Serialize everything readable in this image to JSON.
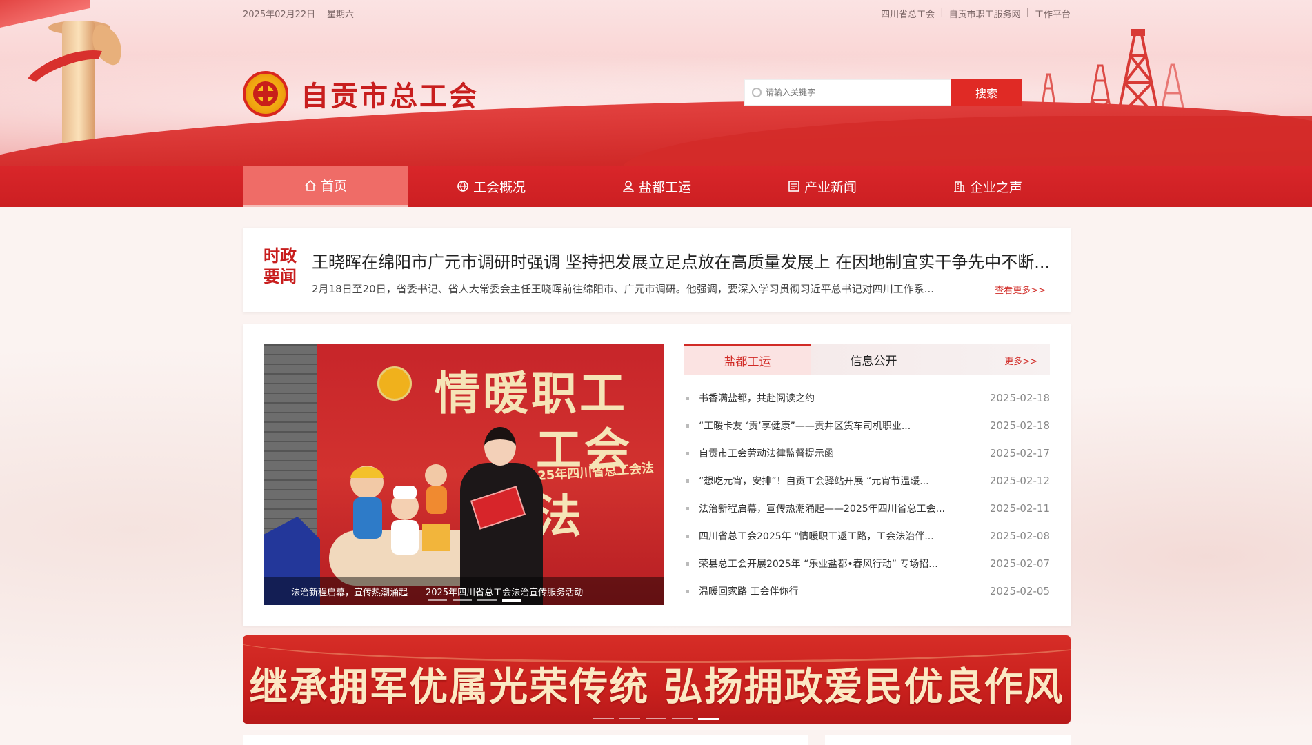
{
  "topbar": {
    "date": "2025年02月22日",
    "weekday": "星期六",
    "links": [
      "四川省总工会",
      "自贡市职工服务网",
      "工作平台"
    ]
  },
  "logo": {
    "name": "自贡市总工会",
    "icon": "union-emblem-icon"
  },
  "search": {
    "placeholder": "请输入关键字",
    "button": "搜索"
  },
  "nav": [
    {
      "label": "首页",
      "icon": "home-icon",
      "active": true
    },
    {
      "label": "工会概况",
      "icon": "globe-icon"
    },
    {
      "label": "盐都工运",
      "icon": "user-icon"
    },
    {
      "label": "产业新闻",
      "icon": "document-icon"
    },
    {
      "label": "企业之声",
      "icon": "building-icon"
    }
  ],
  "headline": {
    "tag_line1": "时政",
    "tag_line2": "要闻",
    "title": "王晓晖在绵阳市广元市调研时强调 坚持把发展立足点放在高质量发展上 在因地制宜实干争先中不断...",
    "summary": "2月18日至20日，省委书记、省人大常委会主任王晓晖前往绵阳市、广元市调研。他强调，要深入学习贯彻习近平总书记对四川工作系...",
    "more": "查看更多>>"
  },
  "carousel": {
    "caption": "法治新程启幕，宣传热潮涌起——2025年四川省总工会法治宣传服务活动",
    "slide_text_1": "情暖职工",
    "slide_text_2": "工会法",
    "slide_text_3": "2025年四川省总工会法",
    "slide_count": 4,
    "active_slide": 4
  },
  "tabs": {
    "items": [
      "盐都工运",
      "信息公开"
    ],
    "more": "更多>>"
  },
  "news_list": [
    {
      "title": "书香满盐都，共赴阅读之约",
      "date": "2025-02-18"
    },
    {
      "title": "“工暖卡友 ‘贡’享健康”——贡井区货车司机职业...",
      "date": "2025-02-18"
    },
    {
      "title": "自贡市工会劳动法律监督提示函",
      "date": "2025-02-17"
    },
    {
      "title": "“想吃元宵，安排”！自贡工会驿站开展 “元宵节温暖...",
      "date": "2025-02-12"
    },
    {
      "title": "法治新程启幕，宣传热潮涌起——2025年四川省总工会...",
      "date": "2025-02-11"
    },
    {
      "title": "四川省总工会2025年 “情暖职工返工路，工会法治伴...",
      "date": "2025-02-08"
    },
    {
      "title": "荣县总工会开展2025年 “乐业盐都•春风行动” 专场招...",
      "date": "2025-02-07"
    },
    {
      "title": "温暖回家路 工会伴你行",
      "date": "2025-02-05"
    }
  ],
  "banner": {
    "text": "继承拥军优属光荣传统  弘扬拥政爱民优良作风",
    "slide_count": 5,
    "active_slide": 5
  },
  "colors": {
    "primary_red": "#d9262a",
    "accent_red": "#d12b26",
    "nav_active": "#ef6c67"
  }
}
